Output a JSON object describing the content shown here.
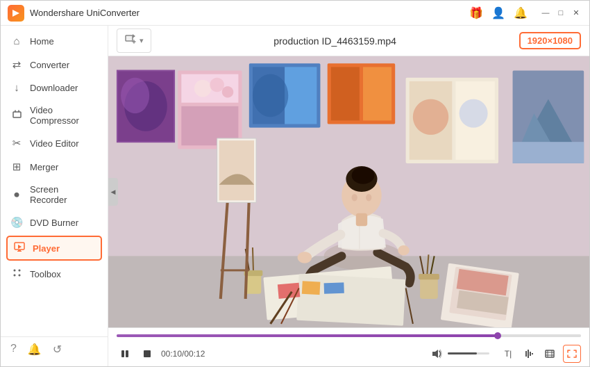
{
  "titleBar": {
    "appName": "Wondershare UniConverter",
    "icons": {
      "gift": "🎁",
      "user": "👤",
      "notification": "🔔"
    },
    "windowControls": {
      "minimize": "—",
      "maximize": "□",
      "close": "✕"
    }
  },
  "sidebar": {
    "items": [
      {
        "id": "home",
        "label": "Home",
        "icon": "⌂",
        "active": false
      },
      {
        "id": "converter",
        "label": "Converter",
        "icon": "⇄",
        "active": false
      },
      {
        "id": "downloader",
        "label": "Downloader",
        "icon": "↓",
        "active": false
      },
      {
        "id": "video-compressor",
        "label": "Video Compressor",
        "icon": "⊡",
        "active": false
      },
      {
        "id": "video-editor",
        "label": "Video Editor",
        "icon": "✂",
        "active": false
      },
      {
        "id": "merger",
        "label": "Merger",
        "icon": "⊞",
        "active": false
      },
      {
        "id": "screen-recorder",
        "label": "Screen Recorder",
        "icon": "⏺",
        "active": false
      },
      {
        "id": "dvd-burner",
        "label": "DVD Burner",
        "icon": "💿",
        "active": false
      },
      {
        "id": "player",
        "label": "Player",
        "icon": "▶",
        "active": true
      },
      {
        "id": "toolbox",
        "label": "Toolbox",
        "icon": "⊞",
        "active": false
      }
    ],
    "footer": {
      "help": "?",
      "bell": "🔔",
      "feedback": "↺"
    }
  },
  "toolbar": {
    "addButtonLabel": "Add Files",
    "addIcon": "📂",
    "dropdownIcon": "▾",
    "fileName": "production ID_4463159.mp4",
    "resolution": "1920×1080"
  },
  "videoPlayer": {
    "collapseIcon": "◀",
    "playPauseIcon": "⏸",
    "stopIcon": "⏹",
    "currentTime": "00:10/00:12",
    "volumeIcon": "🔊",
    "captionsIcon": "T|",
    "waveformIcon": "⌇⌇",
    "cropIcon": "⊠",
    "fullscreenIcon": "⛶"
  }
}
